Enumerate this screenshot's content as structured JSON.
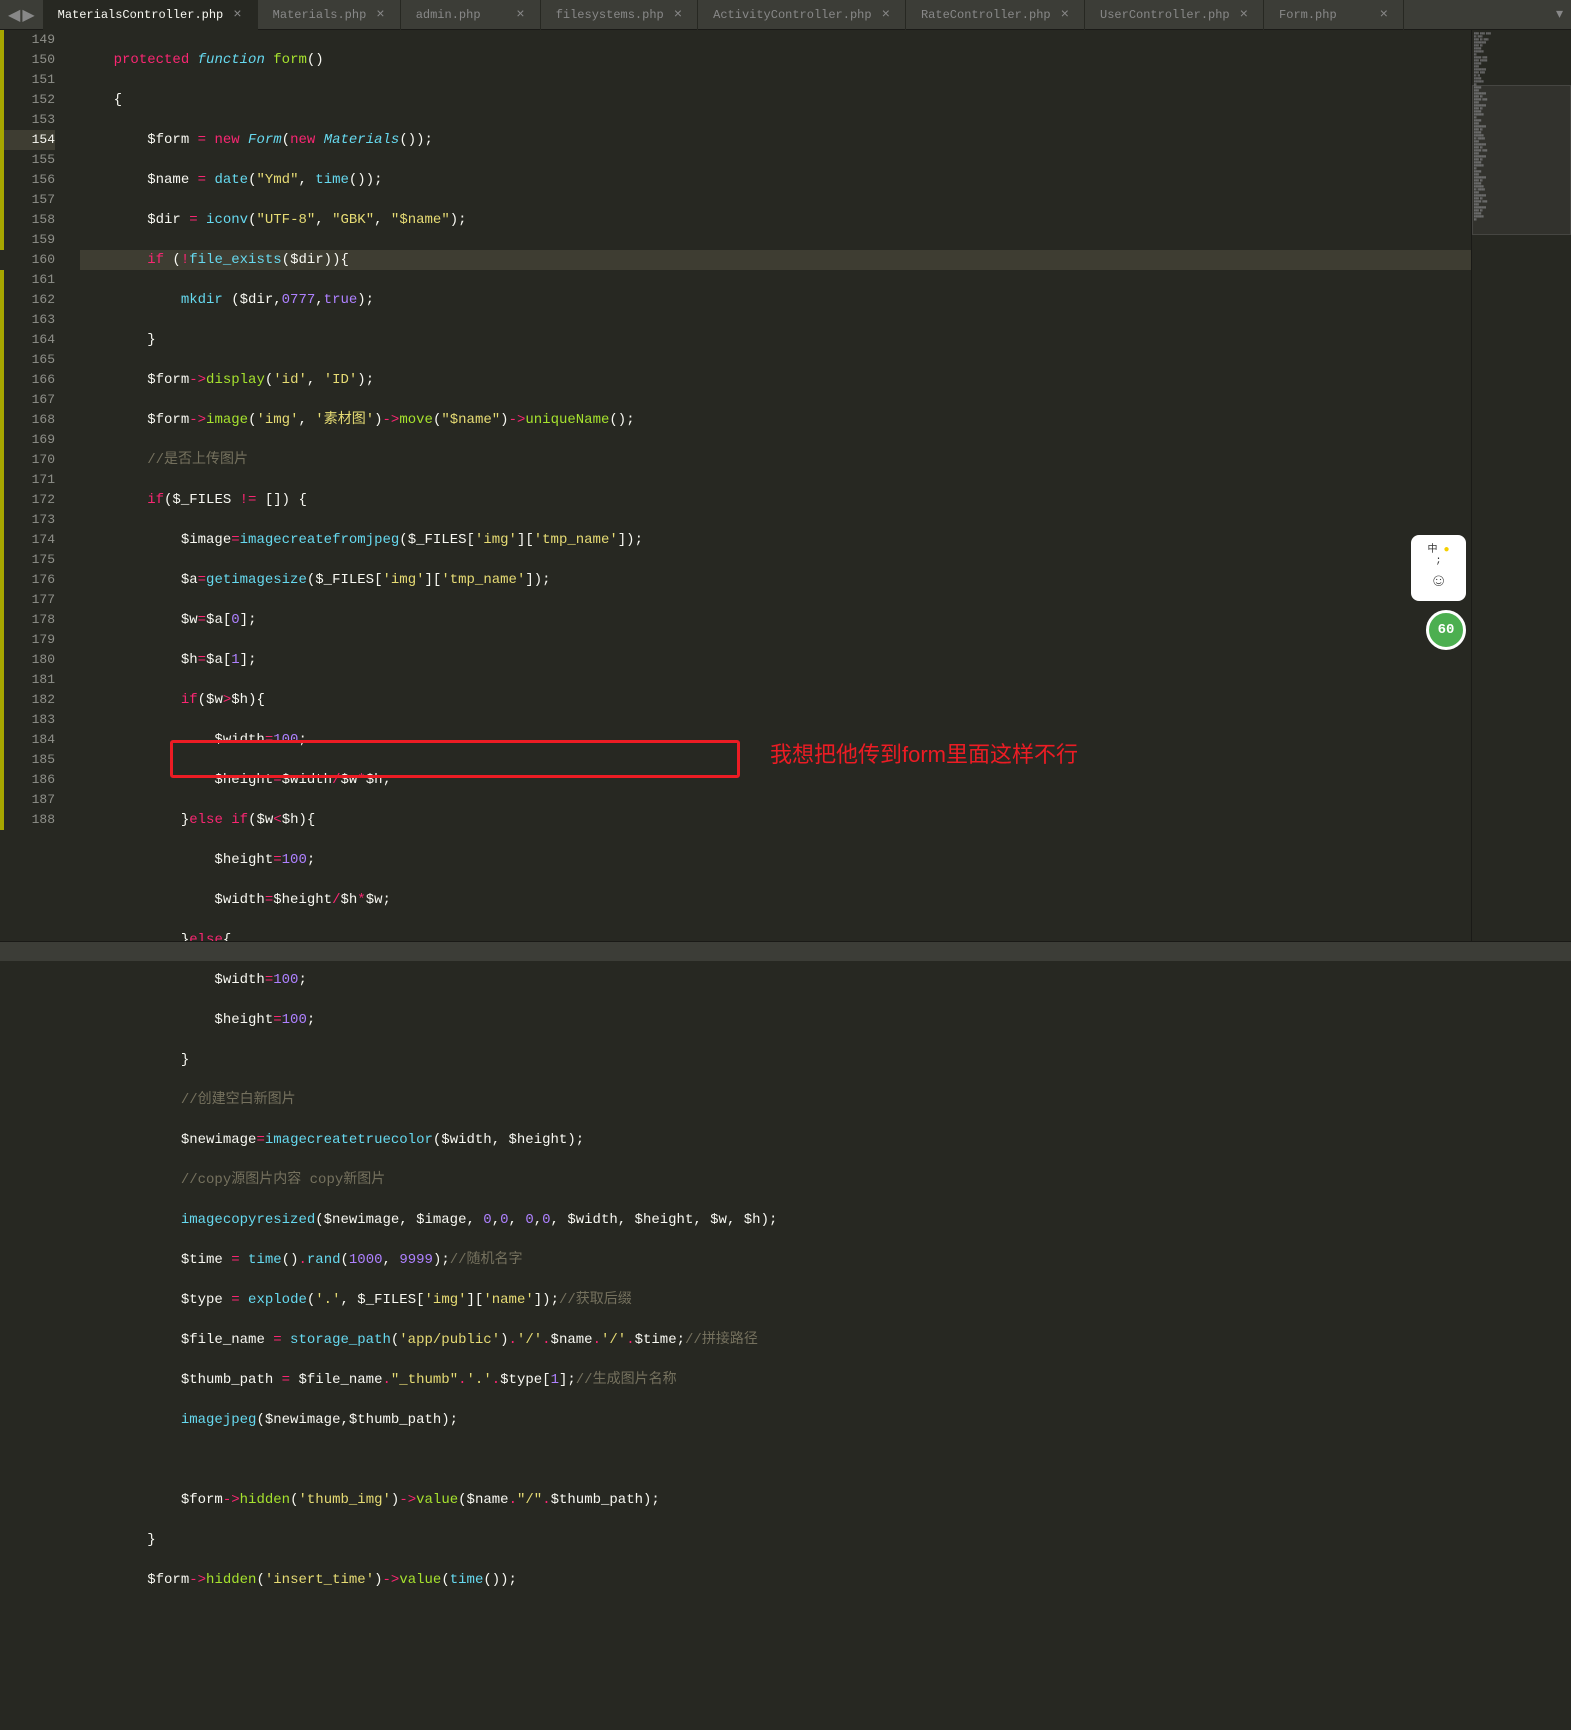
{
  "nav": {
    "back": "◀",
    "forward": "▶"
  },
  "tabs": [
    {
      "label": "MaterialsController.php",
      "active": true
    },
    {
      "label": "Materials.php",
      "active": false
    },
    {
      "label": "admin.php",
      "active": false
    },
    {
      "label": "filesystems.php",
      "active": false
    },
    {
      "label": "ActivityController.php",
      "active": false
    },
    {
      "label": "RateController.php",
      "active": false
    },
    {
      "label": "UserController.php",
      "active": false
    },
    {
      "label": "Form.php",
      "active": false
    }
  ],
  "line_start": 149,
  "line_end": 188,
  "current_line": 154,
  "annotation": {
    "text": "我想把他传到form里面这样不行"
  },
  "badge": {
    "text1": "中",
    "text2": ";",
    "circle_value": "60"
  },
  "code": {
    "l149": {
      "kw1": "protected",
      "kw2": "function",
      "fn": "form",
      "p": "()"
    },
    "l150": {
      "brace": "{"
    },
    "l151": {
      "var1": "$form ",
      "op": "=",
      "kw1": " new",
      "cls1": " Form",
      "p1": "(",
      "kw2": "new",
      "cls2": " Materials",
      "p2": "());"
    },
    "l152": {
      "var1": "$name ",
      "op": "=",
      "fn": " date",
      "p1": "(",
      "str": "\"Ymd\"",
      "p2": ", ",
      "fn2": "time",
      "p3": "());"
    },
    "l153": {
      "var1": "$dir ",
      "op": "=",
      "fn": " iconv",
      "p1": "(",
      "str1": "\"UTF-8\"",
      "p2": ", ",
      "str2": "\"GBK\"",
      "p3": ", ",
      "str3": "\"$name\"",
      "p4": ");"
    },
    "l154": {
      "kw": "if",
      "p1": " (",
      "op": "!",
      "fn": "file_exists",
      "p2": "($dir)){"
    },
    "l155": {
      "fn": "mkdir",
      "p1": " ($dir,",
      "num1": "0777",
      "p2": ",",
      "kw": "true",
      "p3": ");"
    },
    "l156": {
      "brace": "}"
    },
    "l157": {
      "var": "$form",
      "arrow": "->",
      "fn": "display",
      "p1": "(",
      "str1": "'id'",
      "p2": ", ",
      "str2": "'ID'",
      "p3": ");"
    },
    "l158": {
      "var": "$form",
      "arrow1": "->",
      "fn1": "image",
      "p1": "(",
      "str1": "'img'",
      "p2": ", ",
      "str2": "'素材图'",
      "p3": ")",
      "arrow2": "->",
      "fn2": "move",
      "p4": "(",
      "str3": "\"$name\"",
      "p5": ")",
      "arrow3": "->",
      "fn3": "uniqueName",
      "p6": "();"
    },
    "l159": {
      "comment": "//是否上传图片"
    },
    "l160": {
      "kw": "if",
      "p1": "($_FILES ",
      "op": "!=",
      "p2": " []) {"
    },
    "l161": {
      "var1": "$image",
      "op": "=",
      "fn": "imagecreatefromjpeg",
      "p1": "($_FILES[",
      "str1": "'img'",
      "p2": "][",
      "str2": "'tmp_name'",
      "p3": "]);"
    },
    "l162": {
      "var1": "$a",
      "op": "=",
      "fn": "getimagesize",
      "p1": "($_FILES[",
      "str1": "'img'",
      "p2": "][",
      "str2": "'tmp_name'",
      "p3": "]);"
    },
    "l163": {
      "var1": "$w",
      "op": "=",
      "var2": "$a[",
      "num": "0",
      "p": "];"
    },
    "l164": {
      "var1": "$h",
      "op": "=",
      "var2": "$a[",
      "num": "1",
      "p": "];"
    },
    "l165": {
      "kw": "if",
      "p1": "($w",
      "op": ">",
      "p2": "$h){"
    },
    "l166": {
      "var": "$width",
      "op": "=",
      "num": "100",
      "p": ";"
    },
    "l167": {
      "var1": "$height",
      "op1": "=",
      "var2": "$width",
      "op2": "/",
      "var3": "$w",
      "op3": "*",
      "var4": "$h;"
    },
    "l168": {
      "brace": "}",
      "kw1": "else",
      "kw2": " if",
      "p": "($w",
      "op": "<",
      "p2": "$h){"
    },
    "l169": {
      "var": "$height",
      "op": "=",
      "num": "100",
      "p": ";"
    },
    "l170": {
      "var1": "$width",
      "op1": "=",
      "var2": "$height",
      "op2": "/",
      "var3": "$h",
      "op3": "*",
      "var4": "$w;"
    },
    "l171": {
      "brace": "}",
      "kw": "else",
      "p": "{"
    },
    "l172": {
      "var": "$width",
      "op": "=",
      "num": "100",
      "p": ";"
    },
    "l173": {
      "var": "$height",
      "op": "=",
      "num": "100",
      "p": ";"
    },
    "l174": {
      "brace": "}"
    },
    "l175": {
      "comment": "//创建空白新图片"
    },
    "l176": {
      "var": "$newimage",
      "op": "=",
      "fn": "imagecreatetruecolor",
      "p": "($width, $height);"
    },
    "l177": {
      "comment": "//copy源图片内容 copy新图片"
    },
    "l178": {
      "fn": "imagecopyresized",
      "p1": "($newimage, $image, ",
      "n1": "0",
      "p2": ",",
      "n2": "0",
      "p3": ", ",
      "n3": "0",
      "p4": ",",
      "n4": "0",
      "p5": ", $width, $height, $w, $h);"
    },
    "l179": {
      "var": "$time ",
      "op": "=",
      "fn1": " time",
      "p1": "()",
      "dot": ".",
      "fn2": "rand",
      "p2": "(",
      "n1": "1000",
      "p3": ", ",
      "n2": "9999",
      "p4": ");",
      "comment": "//随机名字"
    },
    "l180": {
      "var": "$type ",
      "op": "=",
      "fn": " explode",
      "p1": "(",
      "str1": "'.'",
      "p2": ", $_FILES[",
      "str2": "'img'",
      "p3": "][",
      "str3": "'name'",
      "p4": "]);",
      "comment": "//获取后缀"
    },
    "l181": {
      "var": "$file_name ",
      "op": "=",
      "fn": " storage_path",
      "p1": "(",
      "str1": "'app/public'",
      "p2": ")",
      "dot1": ".",
      "str2": "'/'",
      "dot2": ".",
      "var2": "$name",
      "dot3": ".",
      "str3": "'/'",
      "dot4": ".",
      "var3": "$time;",
      "comment": "//拼接路径"
    },
    "l182": {
      "var1": "$thumb_path ",
      "op": "=",
      "var2": " $file_name",
      "dot1": ".",
      "str1": "\"_thumb\"",
      "dot2": ".",
      "str2": "'.'",
      "dot3": ".",
      "var3": "$type[",
      "num": "1",
      "p": "];",
      "comment": "//生成图片名称"
    },
    "l183": {
      "fn": "imagejpeg",
      "p": "($newimage,$thumb_path);"
    },
    "l185": {
      "var": "$form",
      "arrow1": "->",
      "fn1": "hidden",
      "p1": "(",
      "str1": "'thumb_img'",
      "p2": ")",
      "arrow2": "->",
      "fn2": "value",
      "p3": "($name",
      "dot1": ".",
      "str2": "\"/\"",
      "dot2": ".",
      "p4": "$thumb_path);"
    },
    "l186": {
      "brace": "}"
    },
    "l187": {
      "var": "$form",
      "arrow1": "->",
      "fn1": "hidden",
      "p1": "(",
      "str1": "'insert_time'",
      "p2": ")",
      "arrow2": "->",
      "fn2": "value",
      "p3": "(",
      "fn3": "time",
      "p4": "());"
    }
  }
}
